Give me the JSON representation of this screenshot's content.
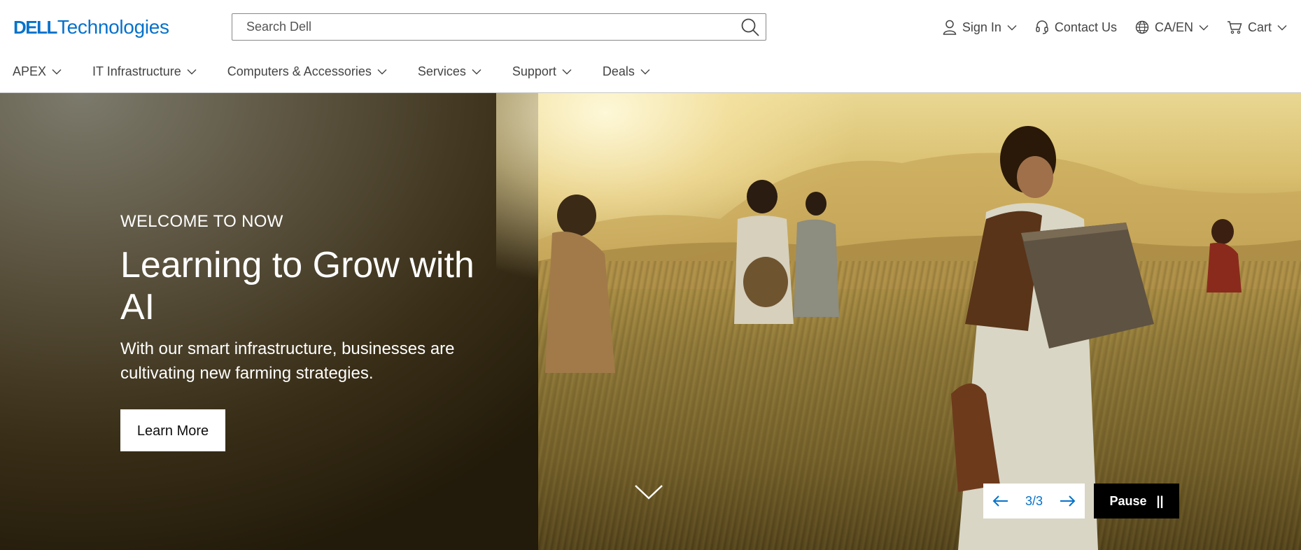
{
  "brand": {
    "dell": "DELL",
    "technologies": "Technologies",
    "accent": "#0672cb"
  },
  "search": {
    "placeholder": "Search Dell",
    "value": ""
  },
  "utility": {
    "sign_in": "Sign In",
    "contact": "Contact Us",
    "locale": "CA/EN",
    "cart": "Cart"
  },
  "nav": {
    "items": [
      {
        "label": "APEX"
      },
      {
        "label": "IT Infrastructure"
      },
      {
        "label": "Computers & Accessories"
      },
      {
        "label": "Services"
      },
      {
        "label": "Support"
      },
      {
        "label": "Deals"
      }
    ]
  },
  "hero": {
    "eyebrow": "WELCOME TO NOW",
    "headline": "Learning to Grow with AI",
    "subhead": "With our smart infrastructure, businesses are cultivating new farming strategies.",
    "cta": "Learn More"
  },
  "carousel": {
    "counter": "3/3",
    "pause_label": "Pause",
    "pause_glyph": "||"
  },
  "icons": [
    "search-icon",
    "user-icon",
    "headset-icon",
    "globe-icon",
    "cart-icon",
    "chevron-down-icon",
    "arrow-left-icon",
    "arrow-right-icon"
  ]
}
